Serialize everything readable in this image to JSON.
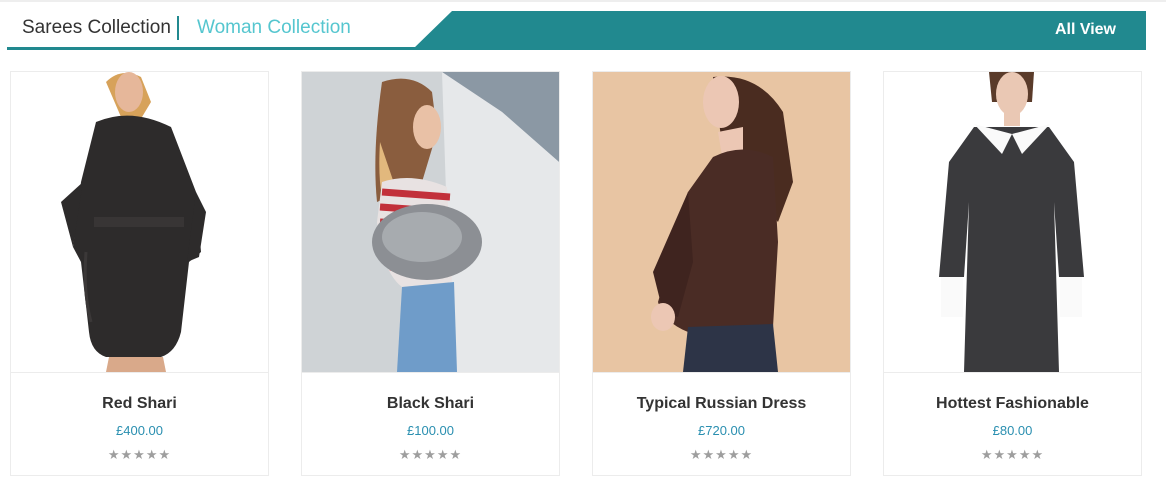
{
  "header": {
    "tabs": [
      {
        "label": "Sarees Collection"
      },
      {
        "label": "Woman Collection"
      }
    ],
    "all_view_label": "All View",
    "accent_color": "#21898f",
    "active_tab_color": "#55c6cf"
  },
  "products": [
    {
      "name": "Red Shari",
      "price": "£400.00",
      "rating": 5,
      "stars": "★★★★★",
      "image": "woman-black-wool-coat-photo"
    },
    {
      "name": "Black Shari",
      "price": "£100.00",
      "rating": 5,
      "stars": "★★★★★",
      "image": "woman-striped-top-jeans-photo"
    },
    {
      "name": "Typical Russian Dress",
      "price": "£720.00",
      "rating": 5,
      "stars": "★★★★★",
      "image": "woman-brown-sweater-photo"
    },
    {
      "name": "Hottest Fashionable",
      "price": "£80.00",
      "rating": 5,
      "stars": "★★★★★",
      "image": "woman-grey-dress-white-collar-photo"
    }
  ],
  "colors": {
    "price": "#2a8fb0",
    "stars": "#9e9e9e",
    "title": "#333333"
  }
}
